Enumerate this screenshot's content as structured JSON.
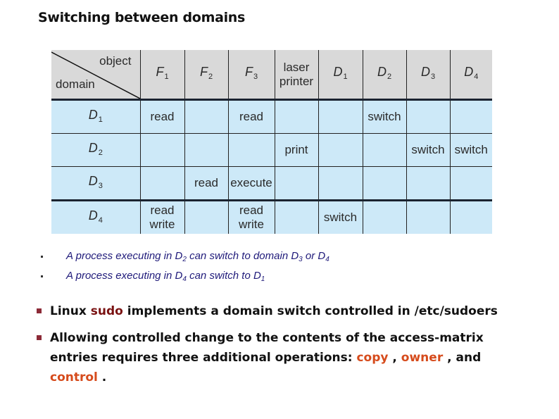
{
  "slide": {
    "title": "Switching between domains"
  },
  "matrix": {
    "corner": {
      "object_label": "object",
      "domain_label": "domain"
    },
    "columns": [
      {
        "base": "F",
        "sub": "1",
        "italic": true
      },
      {
        "base": "F",
        "sub": "2",
        "italic": true
      },
      {
        "base": "F",
        "sub": "3",
        "italic": true
      },
      {
        "line1": "laser",
        "line2": "printer",
        "italic": false
      },
      {
        "base": "D",
        "sub": "1",
        "italic": true
      },
      {
        "base": "D",
        "sub": "2",
        "italic": true
      },
      {
        "base": "D",
        "sub": "3",
        "italic": true
      },
      {
        "base": "D",
        "sub": "4",
        "italic": true
      }
    ],
    "rows": [
      {
        "domain": {
          "base": "D",
          "sub": "1"
        },
        "cells": [
          "read",
          "",
          "read",
          "",
          "",
          "switch",
          "",
          ""
        ]
      },
      {
        "domain": {
          "base": "D",
          "sub": "2"
        },
        "cells": [
          "",
          "",
          "",
          "print",
          "",
          "",
          "switch",
          "switch"
        ]
      },
      {
        "domain": {
          "base": "D",
          "sub": "3"
        },
        "cells": [
          "",
          "read",
          "execute",
          "",
          "",
          "",
          "",
          ""
        ]
      },
      {
        "domain": {
          "base": "D",
          "sub": "4"
        },
        "cells": [
          "read\nwrite",
          "",
          "read\nwrite",
          "",
          "switch",
          "",
          "",
          ""
        ]
      }
    ],
    "colors": {
      "header_bg": "#d9d9d9",
      "body_bg": "#cde9f8",
      "grid": "#222222"
    }
  },
  "sub_bullets": [
    {
      "parts": [
        "A process executing in D",
        "2",
        " can switch to domain D",
        "3",
        " or D",
        "4"
      ]
    },
    {
      "parts": [
        "A process executing in D",
        "4",
        " can switch to D",
        "1"
      ]
    }
  ],
  "bullets": [
    {
      "pre": "Linux ",
      "highlight": "sudo",
      "post": " implements a domain switch controlled in /etc/sudoers"
    },
    {
      "pre": "Allowing controlled change to the contents of the access-matrix entries requires three additional operations: ",
      "op1": "copy",
      "sep1": " , ",
      "op2": "owner",
      "sep2": " , and ",
      "op3": "control",
      "post": " ."
    }
  ],
  "colors": {
    "sub_bullet_text": "#1f1a7a",
    "sudo_highlight": "#7a1212",
    "operation_highlight": "#d64b1c",
    "bullet_square": "#8c2a37"
  }
}
